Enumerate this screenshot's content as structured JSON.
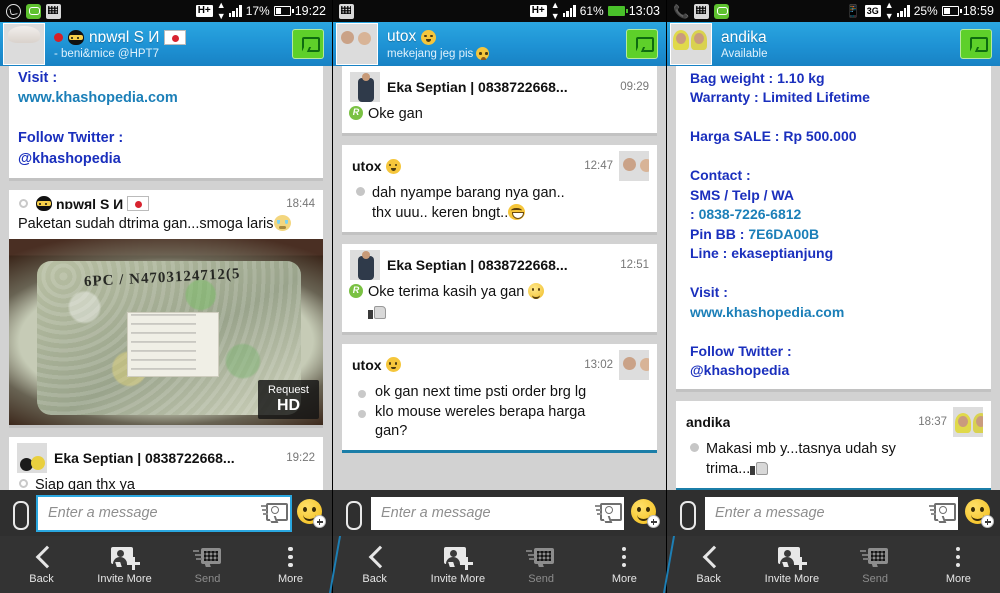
{
  "panels": [
    {
      "id": "panel-1",
      "status": {
        "icons": [
          "whatsapp-icon",
          "line-icon",
          "bbm-icon"
        ],
        "network": "H+",
        "battery_pct": "17%",
        "battery_charging": false,
        "time": "19:22"
      },
      "header": {
        "name": "nɒwяl S И",
        "status_text": "- beni&mice @HPT7",
        "avatar": "anime-avatar",
        "has_red_dot": true,
        "has_ninja_emoji": true,
        "has_jp_flag": true,
        "chat_button": "new-chat-button"
      },
      "messages": [
        {
          "type": "partial-text",
          "lines": [
            "Visit :",
            "www.khashopedia.com",
            "",
            "Follow Twitter :",
            "@khashopedia"
          ]
        },
        {
          "type": "photo",
          "sender": "nɒwяl S И",
          "time": "18:44",
          "text": "Paketan sudah dtrima gan...smoga laris",
          "photo_overlay_small": "Request",
          "photo_overlay_big": "HD",
          "photo_scribble": "6PC / N4703124712(5"
        },
        {
          "type": "text",
          "sender": "Eka Septian | 0838722668...",
          "time": "19:22",
          "avatar": "lamp-avatar",
          "text": "Siap gan thx ya"
        }
      ],
      "composer": {
        "attach": "attach-icon",
        "placeholder": "Enter a message",
        "value": "",
        "focused": true,
        "quick_msg": "quick-message-icon",
        "emoji": "emoji-add-button"
      }
    },
    {
      "id": "panel-2",
      "status": {
        "icons": [
          "bbm-icon"
        ],
        "network": "H+",
        "battery_pct": "61%",
        "battery_charging": true,
        "time": "13:03"
      },
      "header": {
        "name": "utox",
        "status_text": "mekejang jeg pis",
        "avatar": "couple-avatar",
        "has_emoji": true,
        "has_sad_emoji": true,
        "chat_button": "new-chat-button"
      },
      "messages": [
        {
          "type": "text",
          "sender": "Eka Septian | 0838722668...",
          "time": "09:29",
          "avatar": "guy-avatar",
          "badge": "R",
          "text": "Oke gan"
        },
        {
          "type": "text-right",
          "sender": "utox",
          "time": "12:47",
          "avatar": "couple-avatar",
          "lines": [
            "dah nyampe barang nya gan..",
            "thx uuu.. keren bngt.."
          ]
        },
        {
          "type": "text",
          "sender": "Eka Septian | 0838722668...",
          "time": "12:51",
          "avatar": "guy-avatar",
          "badge": "R",
          "lines": [
            "Oke terima kasih ya gan",
            ""
          ]
        },
        {
          "type": "text-right",
          "sender": "utox",
          "time": "13:02",
          "avatar": "couple-avatar",
          "lines": [
            "ok gan next time psti order brg lg",
            "klo mouse wereles berapa harga gan?"
          ]
        }
      ],
      "composer": {
        "attach": "attach-icon",
        "placeholder": "Enter a message",
        "value": "",
        "focused": false,
        "quick_msg": "quick-message-icon",
        "emoji": "emoji-add-button"
      }
    },
    {
      "id": "panel-3",
      "status": {
        "icons": [
          "missed-call-icon",
          "bbm-icon",
          "line-icon"
        ],
        "vibrate": true,
        "network": "3G",
        "battery_pct": "25%",
        "battery_charging": false,
        "time": "18:59"
      },
      "header": {
        "name": "andika",
        "status_text": "Available",
        "avatar": "hijab-avatar",
        "chat_button": "new-chat-button"
      },
      "messages": [
        {
          "type": "partial-text",
          "lines": [
            "Bag weight : 1.10 kg",
            "Warranty : Limited Lifetime",
            "",
            "Harga SALE : Rp 500.000",
            "",
            "Contact :",
            "SMS / Telp / WA",
            ": 0838-7226-6812",
            "Pin BB : 7E6DA00B",
            "Line : ekaseptianjung",
            "",
            "Visit :",
            "www.khashopedia.com",
            "",
            "Follow Twitter :",
            "@khashopedia"
          ]
        },
        {
          "type": "text-right",
          "sender": "andika",
          "time": "18:37",
          "avatar": "hijab-avatar",
          "lines": [
            "Makasi mb y...tasnya udah sy",
            "trima..."
          ]
        }
      ],
      "composer": {
        "attach": "attach-icon",
        "placeholder": "Enter a message",
        "value": "",
        "focused": false,
        "quick_msg": "quick-message-icon",
        "emoji": "emoji-add-button"
      }
    }
  ],
  "navbar": {
    "items": [
      {
        "label": "Back",
        "icon": "back-chevron-icon",
        "dim": false
      },
      {
        "label": "Invite More",
        "icon": "invite-person-icon",
        "dim": false
      },
      {
        "label": "Send",
        "icon": "bbm-send-icon",
        "dim": true
      },
      {
        "label": "More",
        "icon": "more-dots-icon",
        "dim": false
      }
    ]
  },
  "colors": {
    "header_blue": "#1e92d4",
    "accent_teal": "#1b7fb8",
    "link_navy": "#2136c8",
    "navbar_dark": "#333333",
    "selected_underline": "#1b7ea8"
  }
}
